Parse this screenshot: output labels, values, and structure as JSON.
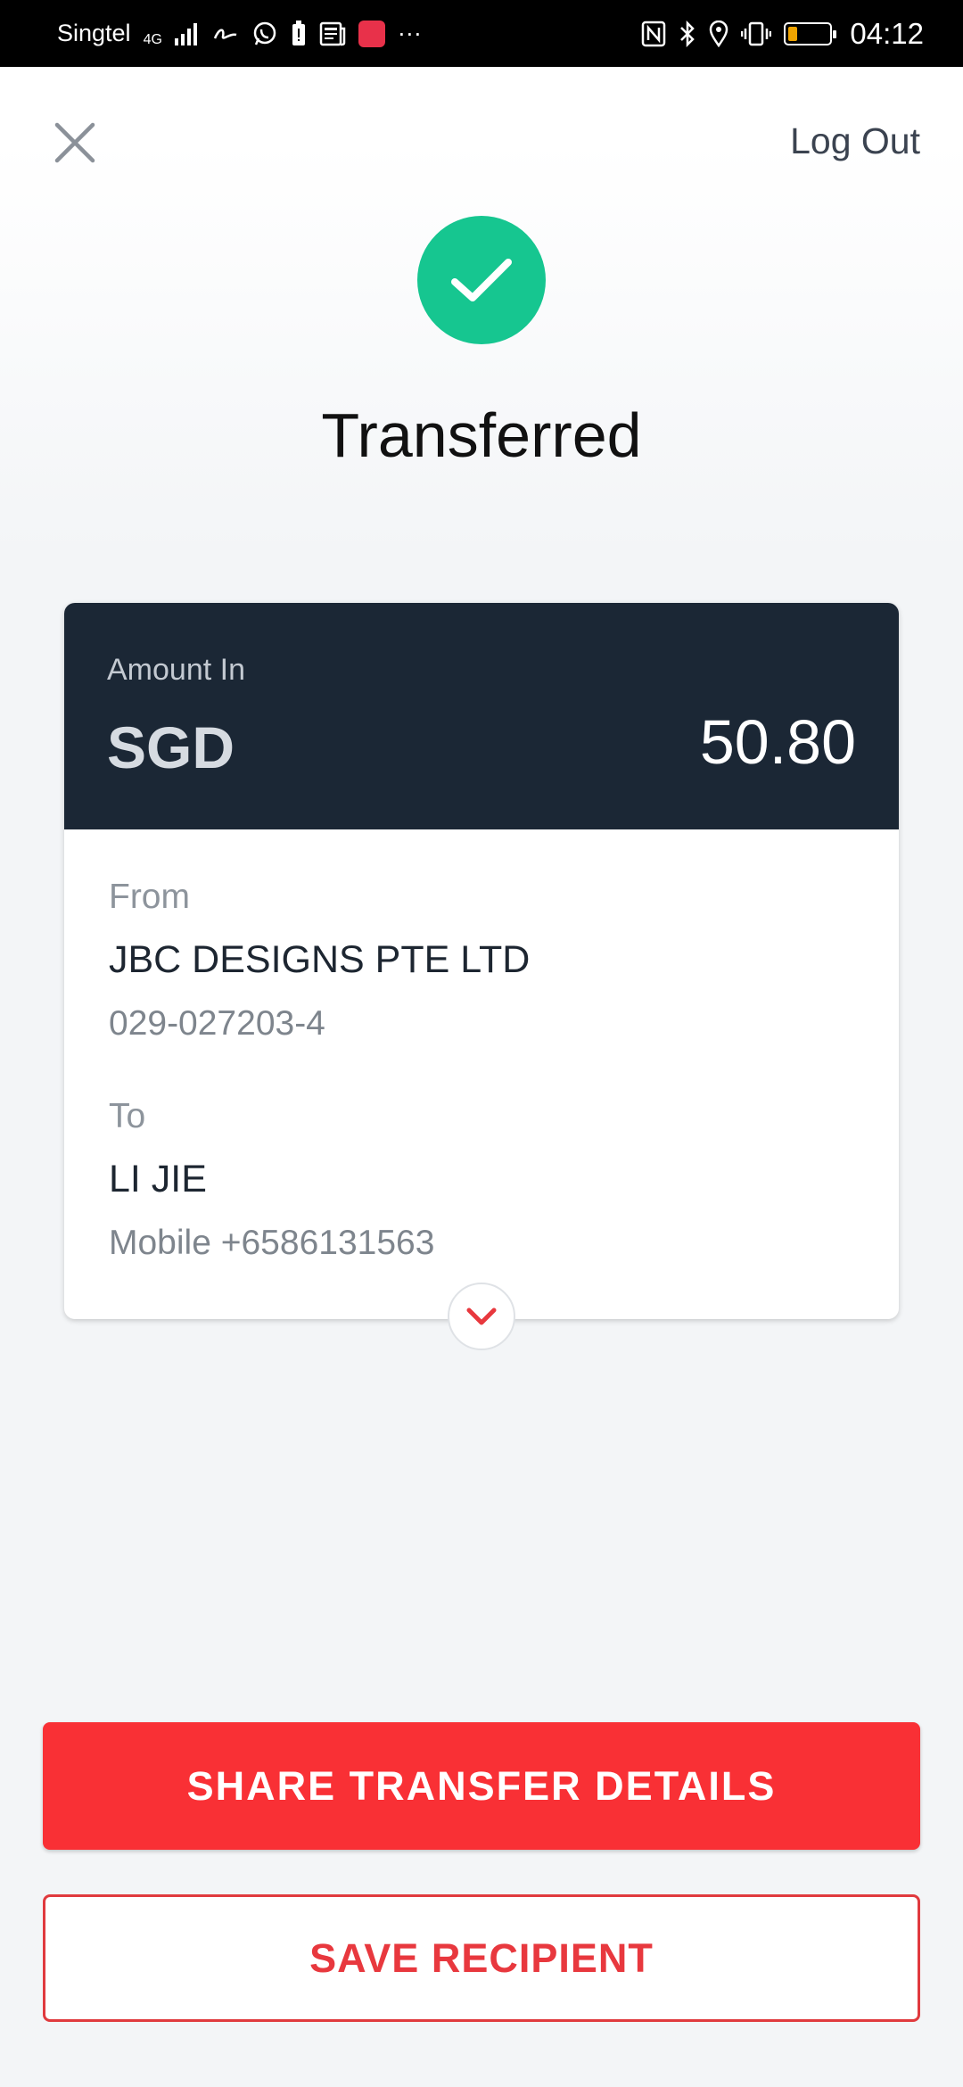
{
  "status_bar": {
    "carrier": "Singtel",
    "network": "4G",
    "more": "···",
    "time": "04:12"
  },
  "header": {
    "logout_label": "Log Out"
  },
  "result": {
    "title": "Transferred"
  },
  "card": {
    "amount_label": "Amount In",
    "currency": "SGD",
    "amount": "50.80",
    "from_label": "From",
    "from_name": "JBC DESIGNS PTE LTD",
    "from_account": "029-027203-4",
    "to_label": "To",
    "to_name": "LI JIE",
    "to_detail": "Mobile +6586131563"
  },
  "actions": {
    "share_label": "SHARE TRANSFER DETAILS",
    "save_label": "SAVE RECIPIENT"
  },
  "colors": {
    "accent": "#f93035",
    "success": "#16c690",
    "card_header": "#1b2735"
  }
}
